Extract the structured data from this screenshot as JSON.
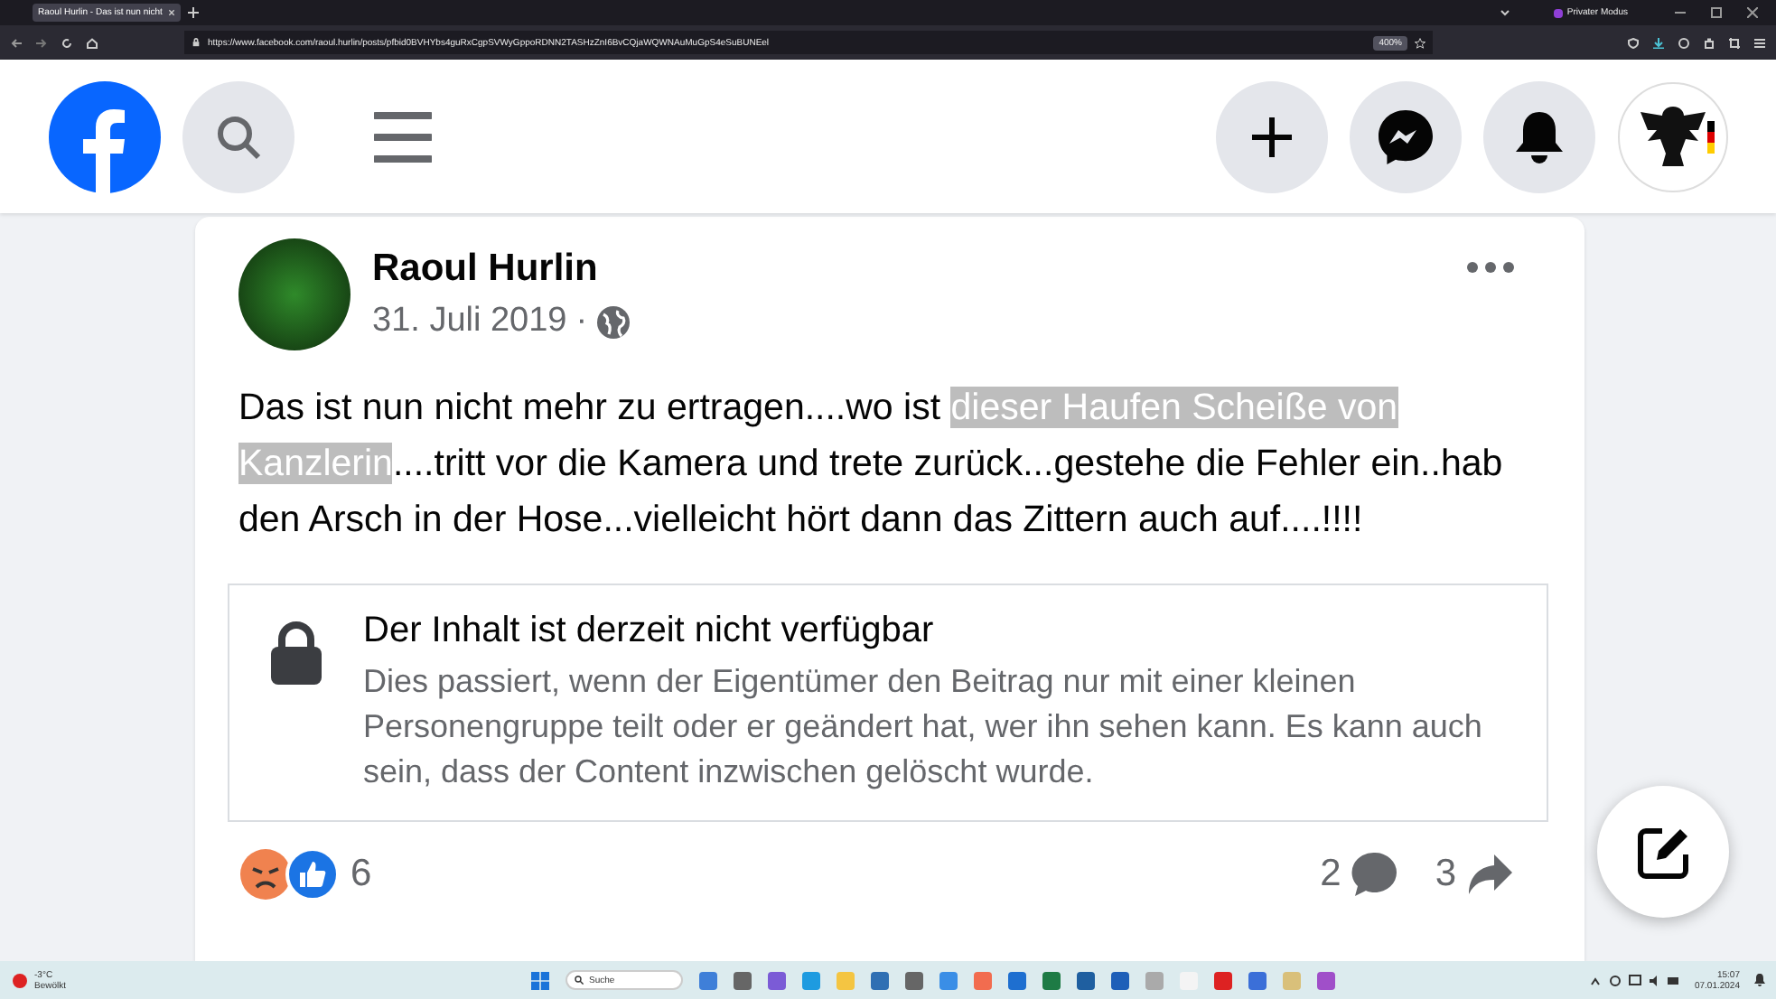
{
  "browser": {
    "tab_title": "Raoul Hurlin - Das ist nun nicht",
    "url": "https://www.facebook.com/raoul.hurlin/posts/pfbid0BVHYbs4guRxCgpSVWyGppoRDNN2TASHzZnI6BvCQjaWQWNAuMuGpS4eSuBUNEel",
    "zoom": "400%",
    "private_mode": "Privater Modus"
  },
  "post": {
    "author": "Raoul Hurlin",
    "date": "31. Juli 2019",
    "separator": "·",
    "text": [
      {
        "text": "Das ist nun nicht mehr zu ertragen....wo ist ",
        "highlighted": false
      },
      {
        "text": "dieser Haufen Scheiße von Kanzlerin",
        "highlighted": true
      },
      {
        "text": "....tritt vor die Kamera und trete zurück...gestehe die Fehler ein..hab den Arsch in der Hose...vielleicht hört dann das Zittern auch auf....!!!!",
        "highlighted": false
      }
    ],
    "unavailable": {
      "title": "Der Inhalt ist derzeit nicht verfügbar",
      "body": "Dies passiert, wenn der Eigentümer den Beitrag nur mit einer kleinen Personengruppe teilt oder er geändert hat, wer ihn sehen kann. Es kann auch sein, dass der Content inzwischen gelöscht wurde."
    },
    "reaction_count": "6",
    "comment_count": "2",
    "share_count": "3"
  },
  "taskbar": {
    "weather_temp": "-3°C",
    "weather_text": "Bewölkt",
    "search_placeholder": "Suche",
    "time": "15:07",
    "date": "07.01.2024"
  }
}
